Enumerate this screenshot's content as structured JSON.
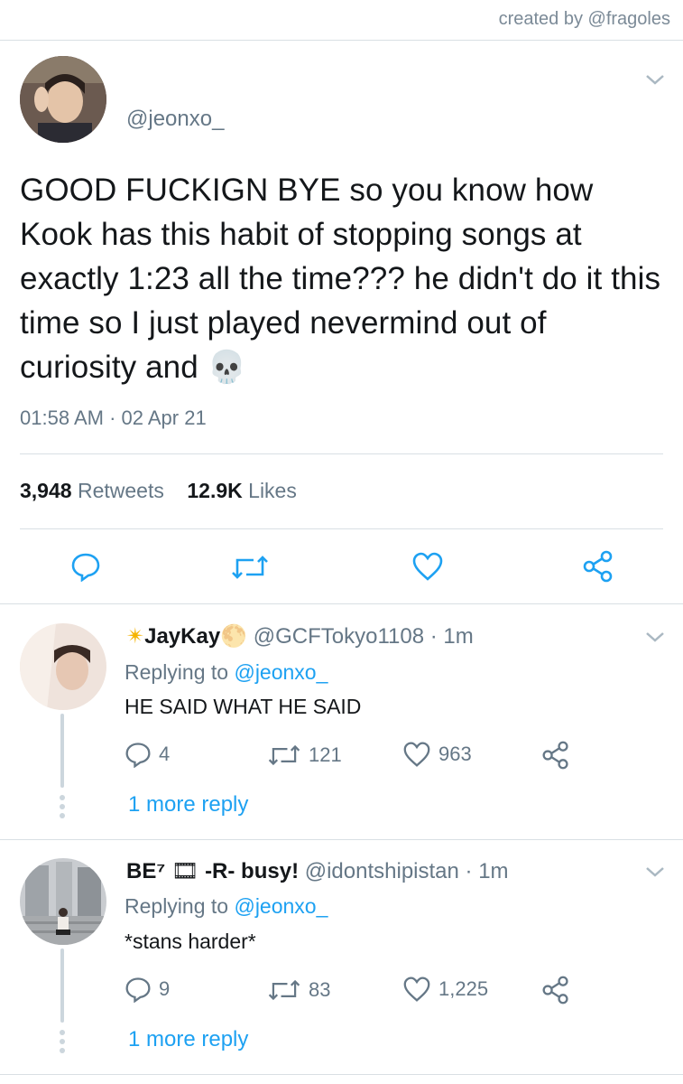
{
  "credit": "created by @fragoles",
  "tweet": {
    "handle": "@jeonxo_",
    "text": "GOOD FUCKIGN BYE so you know how Kook has this habit of stopping songs at exactly 1:23 all the time??? he didn't do it this time so I just played nevermind out of curiosity and 💀",
    "timestamp": "01:58 AM · 02 Apr 21",
    "retweets_count": "3,948",
    "retweets_label": "Retweets",
    "likes_count": "12.9K",
    "likes_label": "Likes"
  },
  "replies": [
    {
      "name_prefix": "✴",
      "name": "JayKay",
      "name_suffix": "🌕",
      "handle": "@GCFTokyo1108",
      "time": "· 1m",
      "replying_label": "Replying to",
      "replying_to": "@jeonxo_",
      "text": "HE SAID WHAT HE SAID",
      "replies": "4",
      "retweets": "121",
      "likes": "963",
      "more": "1 more reply"
    },
    {
      "name_prefix": "",
      "name": "BE⁷",
      "name_suffix": "🎞",
      "name_rest": "-R- busy!",
      "handle": "@idontshipistan",
      "time": "· 1m",
      "replying_label": "Replying to",
      "replying_to": "@jeonxo_",
      "text": "*stans harder*",
      "replies": "9",
      "retweets": "83",
      "likes": "1,225",
      "more": "1 more reply"
    }
  ],
  "colors": {
    "link": "#1da1f2",
    "muted": "#657786",
    "text": "#14171a"
  },
  "icons": [
    "reply-icon",
    "retweet-icon",
    "like-icon",
    "share-icon",
    "chevron-down-icon"
  ]
}
